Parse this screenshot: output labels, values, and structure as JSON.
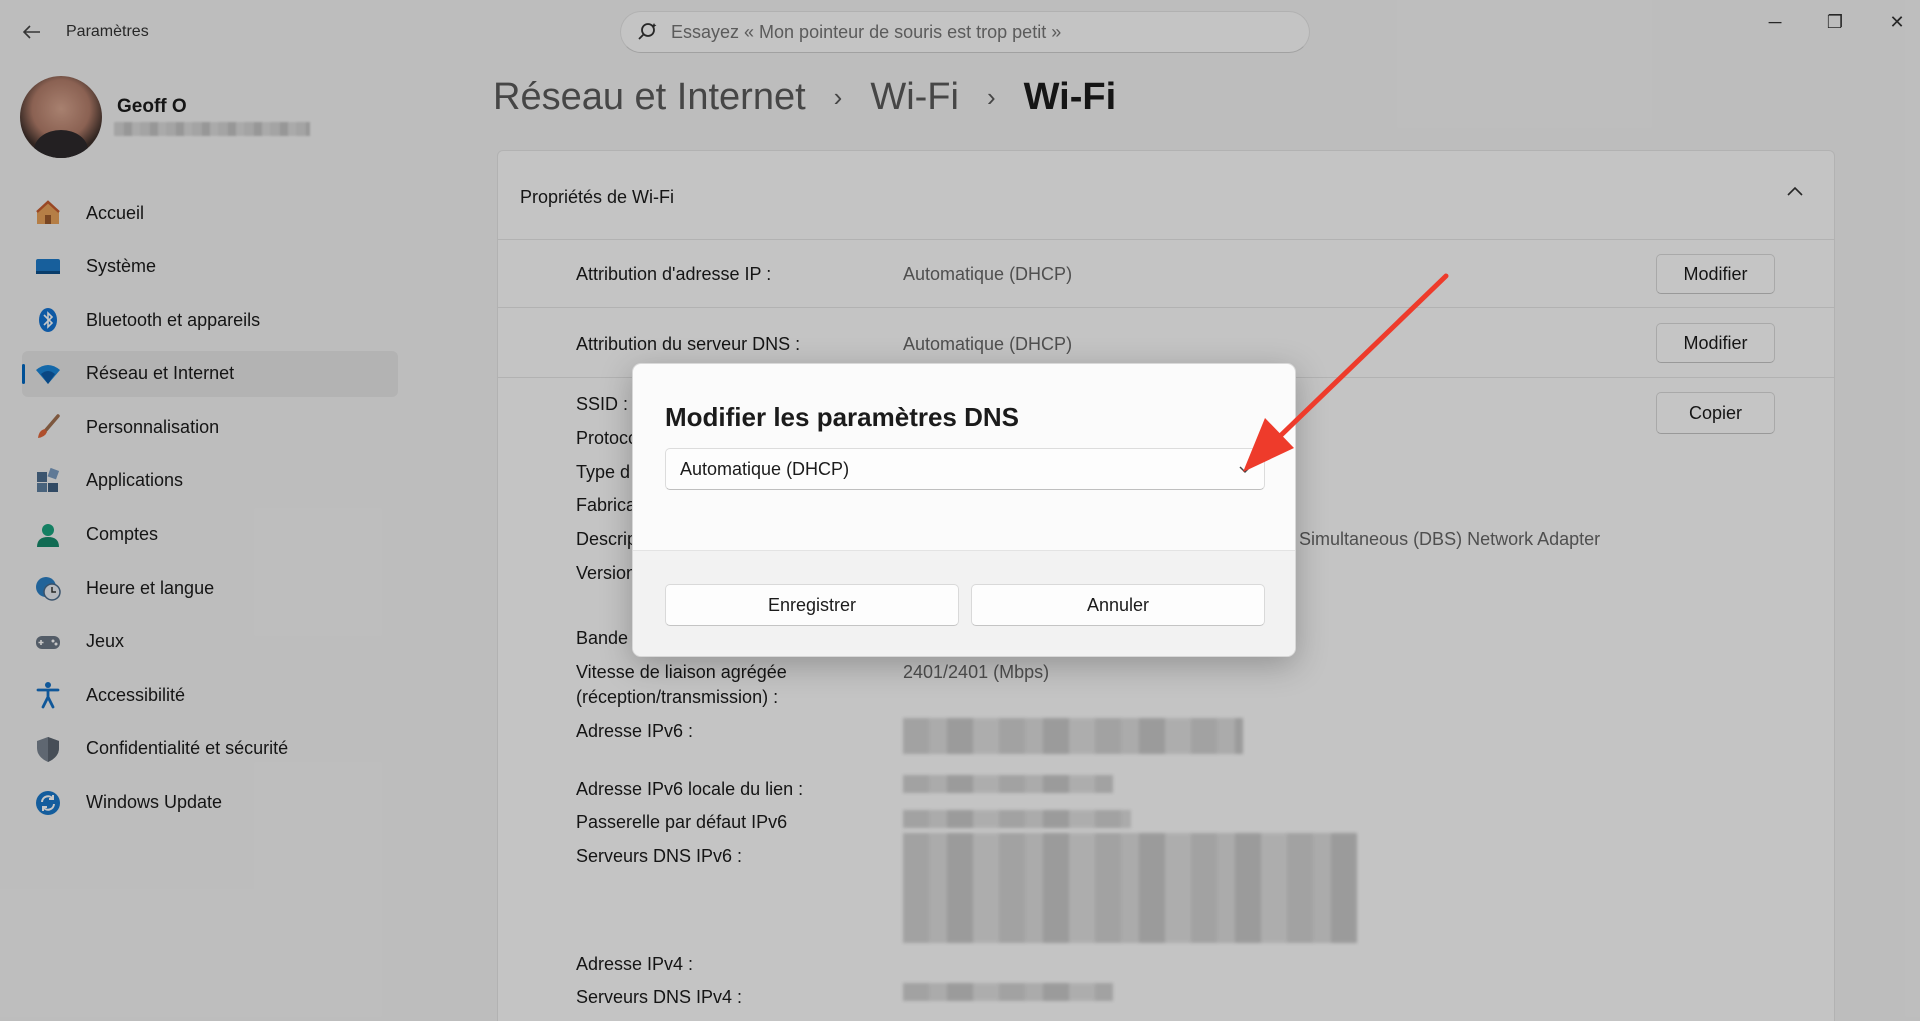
{
  "app": {
    "title": "Paramètres",
    "back_icon": "back-arrow-icon"
  },
  "search": {
    "placeholder": "Essayez « Mon pointeur de souris est trop petit »"
  },
  "window_controls": {
    "minimize": "─",
    "restore": "❐",
    "close": "✕"
  },
  "user": {
    "name": "Geoff O"
  },
  "sidebar": {
    "items": [
      {
        "label": "Accueil",
        "icon": "home-icon",
        "selected": false
      },
      {
        "label": "Système",
        "icon": "system-icon",
        "selected": false
      },
      {
        "label": "Bluetooth et appareils",
        "icon": "bluetooth-icon",
        "selected": false
      },
      {
        "label": "Réseau et Internet",
        "icon": "wifi-icon",
        "selected": true
      },
      {
        "label": "Personnalisation",
        "icon": "brush-icon",
        "selected": false
      },
      {
        "label": "Applications",
        "icon": "apps-icon",
        "selected": false
      },
      {
        "label": "Comptes",
        "icon": "account-icon",
        "selected": false
      },
      {
        "label": "Heure et langue",
        "icon": "clock-globe-icon",
        "selected": false
      },
      {
        "label": "Jeux",
        "icon": "gamepad-icon",
        "selected": false
      },
      {
        "label": "Accessibilité",
        "icon": "accessibility-icon",
        "selected": false
      },
      {
        "label": "Confidentialité et sécurité",
        "icon": "shield-icon",
        "selected": false
      },
      {
        "label": "Windows Update",
        "icon": "update-icon",
        "selected": false
      }
    ]
  },
  "breadcrumb": {
    "level1": "Réseau et Internet",
    "level2": "Wi-Fi",
    "current": "Wi-Fi",
    "separator": "›"
  },
  "card": {
    "title": "Propriétés de Wi-Fi",
    "ip_assignment": {
      "label": "Attribution d'adresse IP :",
      "value": "Automatique (DHCP)",
      "button": "Modifier"
    },
    "dns_assignment": {
      "label": "Attribution du serveur DNS :",
      "value": "Automatique (DHCP)",
      "button": "Modifier"
    },
    "copy_button": "Copier",
    "properties": {
      "ssid": "SSID :",
      "protocol": "Protoco",
      "type": "Type d",
      "manufacturer": "Fabrica",
      "description": "Descrip",
      "description_value": "l Simultaneous (DBS) Network Adapter",
      "version": "Version",
      "band": "Bande",
      "link_speed_line1": "Vitesse de liaison agrégée",
      "link_speed_line2": "(réception/transmission) :",
      "link_speed_value": "2401/2401 (Mbps)",
      "ipv6": "Adresse IPv6 :",
      "ipv6_local": "Adresse IPv6 locale du lien :",
      "ipv6_gateway": "Passerelle par défaut IPv6",
      "ipv6_dns": "Serveurs DNS IPv6 :",
      "ipv4": "Adresse IPv4 :",
      "ipv4_dns": "Serveurs DNS IPv4 :"
    }
  },
  "dialog": {
    "title": "Modifier les paramètres DNS",
    "select_value": "Automatique (DHCP)",
    "save_button": "Enregistrer",
    "cancel_button": "Annuler"
  },
  "colors": {
    "accent": "#0067c0",
    "annotation_arrow": "#ee3b2b"
  }
}
